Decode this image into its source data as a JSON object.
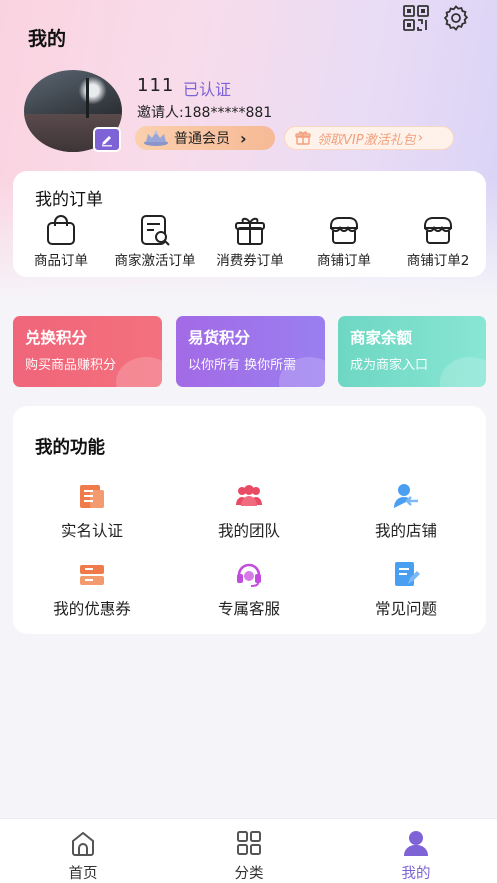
{
  "header": {
    "title": "我的",
    "qr_icon": "qr-code-icon",
    "settings_icon": "gear-icon"
  },
  "profile": {
    "username": "111",
    "verified_label": "已认证",
    "inviter": "邀请人:188*****881",
    "member_level": "普通会员",
    "vip_promo": "领取VIP激活礼包"
  },
  "orders": {
    "title": "我的订单",
    "items": [
      {
        "label": "商品订单",
        "icon": "shopping-bag-icon"
      },
      {
        "label": "商家激活订单",
        "icon": "document-search-icon"
      },
      {
        "label": "消费券订单",
        "icon": "gift-icon"
      },
      {
        "label": "商铺订单",
        "icon": "store-icon"
      },
      {
        "label": "商铺订单2",
        "icon": "store-icon"
      }
    ]
  },
  "points": [
    {
      "title": "兑换积分",
      "subtitle": "购买商品赚积分",
      "color": "#f0657a"
    },
    {
      "title": "易货积分",
      "subtitle": "以你所有 换你所需",
      "color": "#a36ae6"
    },
    {
      "title": "商家余额",
      "subtitle": "成为商家入口",
      "color": "#6ed7c3"
    }
  ],
  "functions": {
    "title": "我的功能",
    "items": [
      {
        "label": "实名认证",
        "icon": "id-card-icon",
        "color": "#f07a4a"
      },
      {
        "label": "我的团队",
        "icon": "team-icon",
        "color": "#ea4b64"
      },
      {
        "label": "我的店铺",
        "icon": "user-store-icon",
        "color": "#4a9ff0"
      },
      {
        "label": "我的优惠券",
        "icon": "coupon-icon",
        "color": "#f07a4a"
      },
      {
        "label": "专属客服",
        "icon": "headset-icon",
        "color": "#c24ddc"
      },
      {
        "label": "常见问题",
        "icon": "faq-document-icon",
        "color": "#4a9ff0"
      }
    ]
  },
  "tabbar": {
    "items": [
      {
        "label": "首页",
        "icon": "home-icon",
        "active": false
      },
      {
        "label": "分类",
        "icon": "grid-icon",
        "active": false
      },
      {
        "label": "我的",
        "icon": "profile-icon",
        "active": true
      }
    ]
  },
  "colors": {
    "accent": "#7e63d7",
    "member_pill": "#f6b995",
    "vip_text": "#f0a07c"
  }
}
